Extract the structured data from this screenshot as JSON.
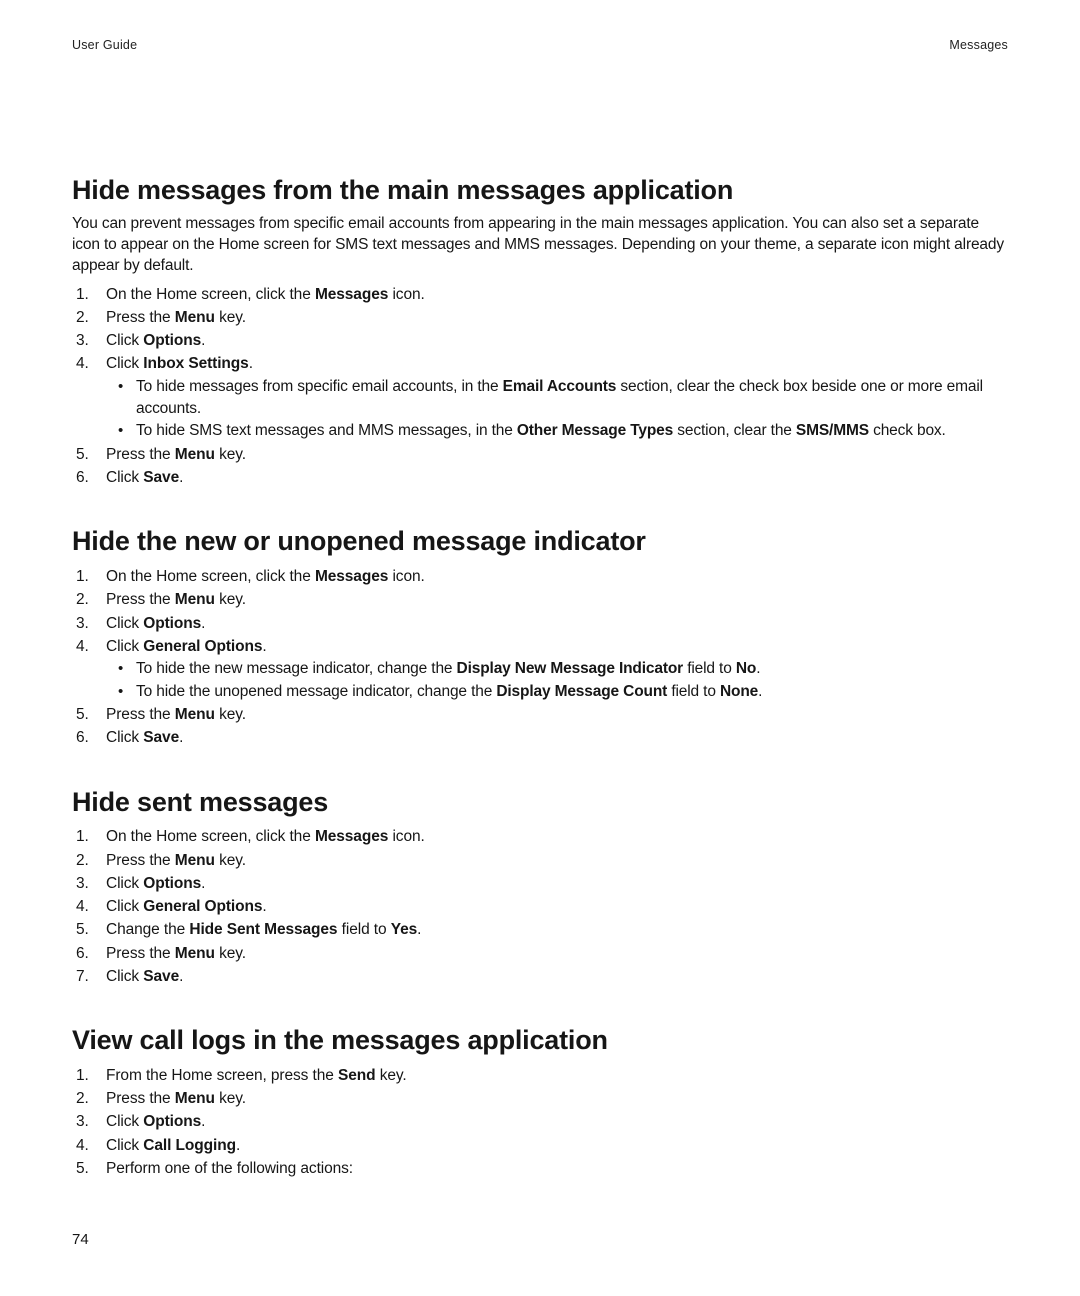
{
  "header": {
    "left": "User Guide",
    "right": "Messages"
  },
  "page_number": "74",
  "sections": [
    {
      "title": "Hide messages from the main messages application",
      "intro": "You can prevent messages from specific email accounts from appearing in the main messages application. You can also set a separate icon to appear on the Home screen for SMS text messages and MMS messages. Depending on your theme, a separate icon might already appear by default.",
      "steps": [
        {
          "text": [
            "On the Home screen, click the ",
            "Messages",
            " icon."
          ]
        },
        {
          "text": [
            "Press the ",
            "Menu",
            " key."
          ]
        },
        {
          "text": [
            "Click ",
            "Options",
            "."
          ]
        },
        {
          "text": [
            "Click ",
            "Inbox Settings",
            "."
          ],
          "sub": [
            [
              "To hide messages from specific email accounts, in the ",
              "Email Accounts",
              " section, clear the check box beside one or more email accounts."
            ],
            [
              "To hide SMS text messages and MMS messages, in the ",
              "Other Message Types",
              " section, clear the ",
              "SMS/MMS",
              " check box."
            ]
          ]
        },
        {
          "text": [
            "Press the ",
            "Menu",
            " key."
          ]
        },
        {
          "text": [
            "Click ",
            "Save",
            "."
          ]
        }
      ]
    },
    {
      "title": "Hide the new or unopened message indicator",
      "steps": [
        {
          "text": [
            "On the Home screen, click the ",
            "Messages",
            " icon."
          ]
        },
        {
          "text": [
            "Press the ",
            "Menu",
            " key."
          ]
        },
        {
          "text": [
            "Click ",
            "Options",
            "."
          ]
        },
        {
          "text": [
            "Click ",
            "General Options",
            "."
          ],
          "sub": [
            [
              "To hide the new message indicator, change the ",
              "Display New Message Indicator",
              " field to ",
              "No",
              "."
            ],
            [
              "To hide the unopened message indicator, change the ",
              "Display Message Count",
              " field to ",
              "None",
              "."
            ]
          ]
        },
        {
          "text": [
            "Press the ",
            "Menu",
            " key."
          ]
        },
        {
          "text": [
            "Click ",
            "Save",
            "."
          ]
        }
      ]
    },
    {
      "title": "Hide sent messages",
      "steps": [
        {
          "text": [
            "On the Home screen, click the ",
            "Messages",
            " icon."
          ]
        },
        {
          "text": [
            "Press the ",
            "Menu",
            " key."
          ]
        },
        {
          "text": [
            "Click ",
            "Options",
            "."
          ]
        },
        {
          "text": [
            "Click ",
            "General Options",
            "."
          ]
        },
        {
          "text": [
            "Change the ",
            "Hide Sent Messages",
            " field to ",
            "Yes",
            "."
          ]
        },
        {
          "text": [
            "Press the ",
            "Menu",
            " key."
          ]
        },
        {
          "text": [
            "Click ",
            "Save",
            "."
          ]
        }
      ]
    },
    {
      "title": "View call logs in the messages application",
      "steps": [
        {
          "text": [
            "From the Home screen, press the ",
            "Send",
            " key."
          ]
        },
        {
          "text": [
            "Press the ",
            "Menu",
            " key."
          ]
        },
        {
          "text": [
            "Click ",
            "Options",
            "."
          ]
        },
        {
          "text": [
            "Click ",
            "Call Logging",
            "."
          ]
        },
        {
          "text": [
            "Perform one of the following actions:"
          ]
        }
      ]
    }
  ]
}
